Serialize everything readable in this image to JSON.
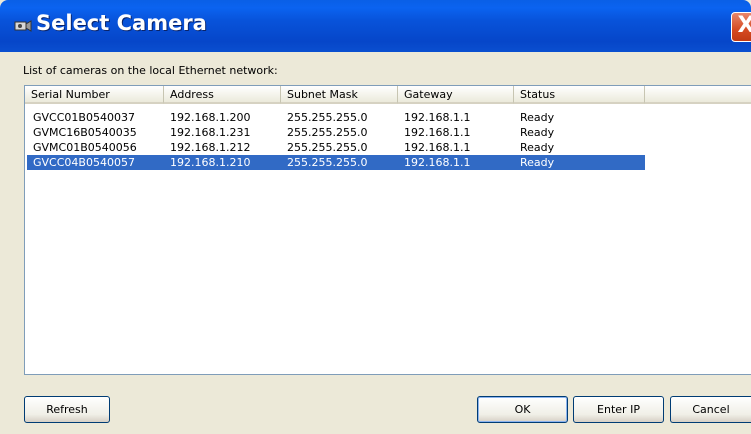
{
  "window": {
    "title": "Select Camera",
    "close_glyph": "X"
  },
  "description": "List of cameras on the local Ethernet network:",
  "columns": [
    "Serial Number",
    "Address",
    "Subnet Mask",
    "Gateway",
    "Status"
  ],
  "rows": [
    [
      "GVCC01B0540037",
      "192.168.1.200",
      "255.255.255.0",
      "192.168.1.1",
      "Ready"
    ],
    [
      "GVMC16B0540035",
      "192.168.1.231",
      "255.255.255.0",
      "192.168.1.1",
      "Ready"
    ],
    [
      "GVMC01B0540056",
      "192.168.1.212",
      "255.255.255.0",
      "192.168.1.1",
      "Ready"
    ],
    [
      "GVCC04B0540057",
      "192.168.1.210",
      "255.255.255.0",
      "192.168.1.1",
      "Ready"
    ]
  ],
  "selected_row": 3,
  "buttons": {
    "refresh": "Refresh",
    "ok": "OK",
    "enter_ip": "Enter IP",
    "cancel": "Cancel"
  },
  "icons": {
    "title_icon": "camera-icon",
    "close": "close-icon"
  },
  "colors": {
    "titlebar": "#0853da",
    "selection": "#316ac5",
    "close": "#d54a22"
  }
}
